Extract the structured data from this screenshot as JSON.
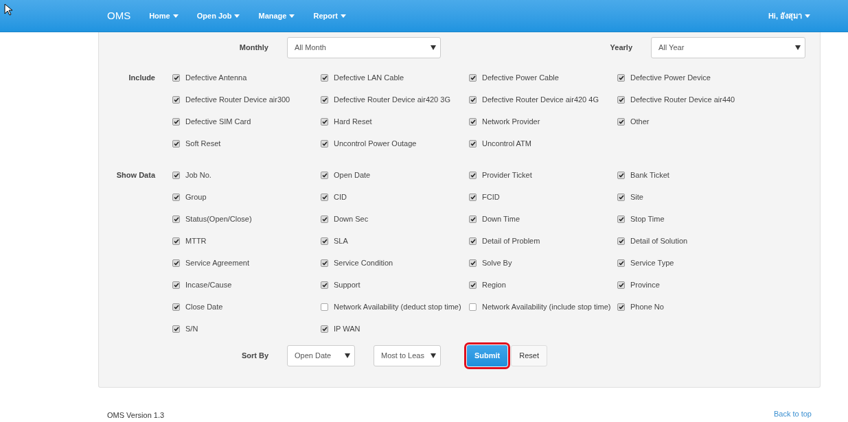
{
  "navbar": {
    "brand": "OMS",
    "menus": [
      {
        "label": "Home"
      },
      {
        "label": "Open Job"
      },
      {
        "label": "Manage"
      },
      {
        "label": "Report"
      }
    ],
    "user": "Hi, อังสุมา"
  },
  "filters": [
    {
      "label": "Monthly",
      "value": "All Month"
    },
    {
      "label": "Yearly",
      "value": "All Year"
    }
  ],
  "groups": [
    {
      "label": "Include",
      "items": [
        {
          "label": "Defective Antenna",
          "checked": true
        },
        {
          "label": "Defective LAN Cable",
          "checked": true
        },
        {
          "label": "Defective Power Cable",
          "checked": true
        },
        {
          "label": "Defective Power Device",
          "checked": true
        },
        {
          "label": "Defective Router Device air300",
          "checked": true
        },
        {
          "label": "Defective Router Device air420 3G",
          "checked": true
        },
        {
          "label": "Defective Router Device air420 4G",
          "checked": true
        },
        {
          "label": "Defective Router Device air440",
          "checked": true
        },
        {
          "label": "Defective SIM Card",
          "checked": true
        },
        {
          "label": "Hard Reset",
          "checked": true
        },
        {
          "label": "Network Provider",
          "checked": true
        },
        {
          "label": "Other",
          "checked": true
        },
        {
          "label": "Soft Reset",
          "checked": true
        },
        {
          "label": "Uncontrol Power Outage",
          "checked": true
        },
        {
          "label": "Uncontrol ATM",
          "checked": true
        }
      ]
    },
    {
      "label": "Show Data",
      "items": [
        {
          "label": "Job No.",
          "checked": true
        },
        {
          "label": "Open Date",
          "checked": true
        },
        {
          "label": "Provider Ticket",
          "checked": true
        },
        {
          "label": "Bank Ticket",
          "checked": true
        },
        {
          "label": "Group",
          "checked": true
        },
        {
          "label": "CID",
          "checked": true
        },
        {
          "label": "FCID",
          "checked": true
        },
        {
          "label": "Site",
          "checked": true
        },
        {
          "label": "Status(Open/Close)",
          "checked": true
        },
        {
          "label": "Down Sec",
          "checked": true
        },
        {
          "label": "Down Time",
          "checked": true
        },
        {
          "label": "Stop Time",
          "checked": true
        },
        {
          "label": "MTTR",
          "checked": true
        },
        {
          "label": "SLA",
          "checked": true
        },
        {
          "label": "Detail of Problem",
          "checked": true
        },
        {
          "label": "Detail of Solution",
          "checked": true
        },
        {
          "label": "Service Agreement",
          "checked": true
        },
        {
          "label": "Service Condition",
          "checked": true
        },
        {
          "label": "Solve By",
          "checked": true
        },
        {
          "label": "Service Type",
          "checked": true
        },
        {
          "label": "Incase/Cause",
          "checked": true
        },
        {
          "label": "Support",
          "checked": true
        },
        {
          "label": "Region",
          "checked": true
        },
        {
          "label": "Province",
          "checked": true
        },
        {
          "label": "Close Date",
          "checked": true
        },
        {
          "label": "Network Availability (deduct stop time)",
          "checked": false
        },
        {
          "label": "Network Availability (include stop time)",
          "checked": false
        },
        {
          "label": "Phone No",
          "checked": true
        },
        {
          "label": "S/N",
          "checked": true
        },
        {
          "label": "IP WAN",
          "checked": true
        }
      ]
    }
  ],
  "sort": {
    "label": "Sort By",
    "field": "Open Date",
    "order": "Most to Leas"
  },
  "buttons": [
    {
      "label": "Submit",
      "kind": "primary",
      "highlighted": true
    },
    {
      "label": "Reset",
      "kind": "default",
      "highlighted": false
    }
  ],
  "footer": {
    "version": "OMS Version 1.3",
    "back_to_top": "Back to top"
  }
}
